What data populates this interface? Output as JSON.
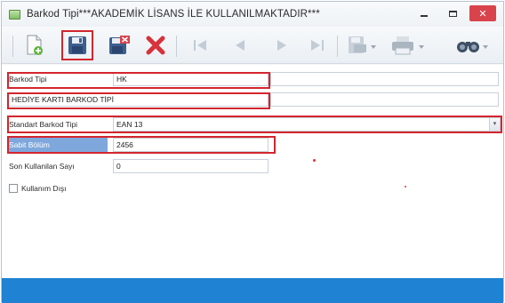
{
  "window": {
    "title": "Barkod Tipi***AKADEMİK LİSANS İLE KULLANILMAKTADIR***",
    "accent_color": "#1f82d2",
    "highlight_color": "#d3262e"
  },
  "toolbar": {
    "buttons": [
      "new-icon",
      "save-icon",
      "save-close-icon",
      "delete-icon",
      "first-icon",
      "previous-icon",
      "next-icon",
      "last-icon",
      "export-icon",
      "print-icon",
      "search-binoculars-icon"
    ]
  },
  "form": {
    "barkod_tipi_label": "Barkod Tipi",
    "barkod_tipi_value": "HK",
    "aciklama_value": "HEDİYE KARTI BARKOD TİPİ",
    "standart_label": "Standart Barkod Tipi",
    "standart_value": "EAN 13",
    "sabit_bolum_label": "Sabit Bölüm",
    "sabit_bolum_value": "2456",
    "son_kullanilan_label": "Son Kullanilan Sayı",
    "son_kullanilan_value": "0",
    "kullanim_disi_label": "Kullanım Dışı"
  }
}
